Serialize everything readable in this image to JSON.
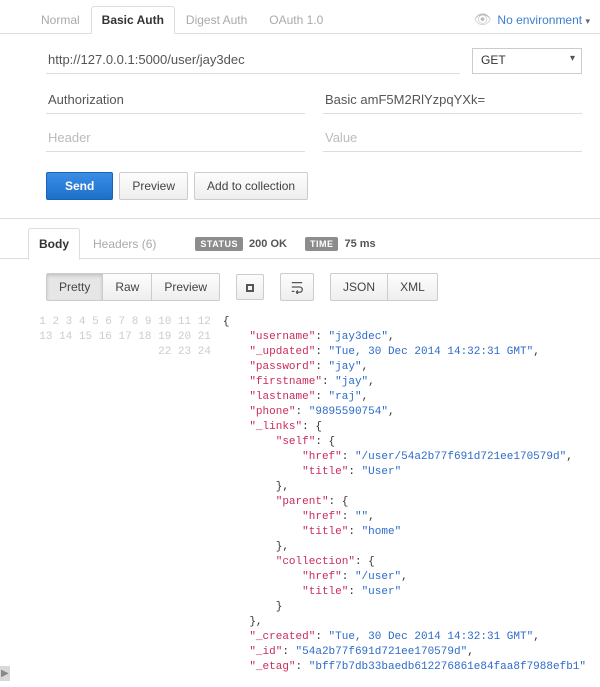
{
  "auth_tabs": {
    "normal": "Normal",
    "basic": "Basic Auth",
    "digest": "Digest Auth",
    "oauth": "OAuth 1.0"
  },
  "env": {
    "label": "No environment"
  },
  "request": {
    "url": "http://127.0.0.1:5000/user/jay3dec",
    "method": "GET"
  },
  "headers_form": {
    "name_value": "Authorization",
    "val_value": "Basic amF5M2RlYzpqYXk=",
    "name_placeholder": "Header",
    "val_placeholder": "Value"
  },
  "buttons": {
    "send": "Send",
    "preview": "Preview",
    "add_collection": "Add to collection"
  },
  "response_tabs": {
    "body": "Body",
    "headers": "Headers (6)"
  },
  "status": {
    "label": "STATUS",
    "value": "200 OK"
  },
  "time": {
    "label": "TIME",
    "value": "75 ms"
  },
  "format": {
    "pretty": "Pretty",
    "raw": "Raw",
    "preview": "Preview",
    "json": "JSON",
    "xml": "XML"
  },
  "body_json": {
    "username": "jay3dec",
    "_updated": "Tue, 30 Dec 2014 14:32:31 GMT",
    "password": "jay",
    "firstname": "jay",
    "lastname": "raj",
    "phone": "9895590754",
    "_links": {
      "self": {
        "href": "/user/54a2b77f691d721ee170579d",
        "title": "User"
      },
      "parent": {
        "href": "",
        "title": "home"
      },
      "collection": {
        "href": "/user",
        "title": "user"
      }
    },
    "_created": "Tue, 30 Dec 2014 14:32:31 GMT",
    "_id": "54a2b77f691d721ee170579d",
    "_etag": "bff7b7db33baedb612276861e84faa8f7988efb1"
  }
}
